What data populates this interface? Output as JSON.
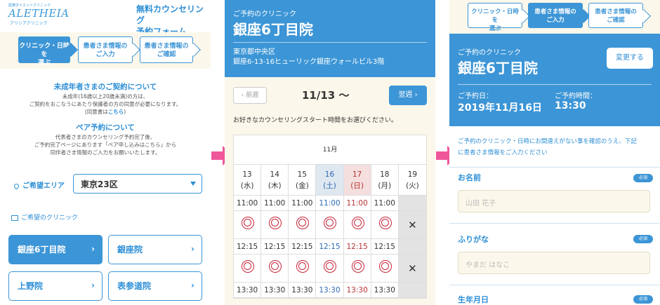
{
  "screen1": {
    "logo_sub": "医療ダイエットクリニック",
    "logo": "ALETHEIA",
    "logo_jp": "アリシアクリニック",
    "form_title_1": "無料カウンセリング",
    "form_title_2": "予約フォーム",
    "steps": [
      {
        "l1": "クリニック・日時を",
        "l2": "選ぶ"
      },
      {
        "l1": "患者さま情報の",
        "l2": "ご入力"
      },
      {
        "l1": "患者さま情報の",
        "l2": "ご確認"
      }
    ],
    "minor_heading": "未成年者さまのご契約について",
    "minor_text_1": "未成年(16歳以上20歳未満)の方は、",
    "minor_text_2": "ご契約をおこなうにあたり保護者の方の同意が必要になります。",
    "minor_text_3a": "(同意書は",
    "minor_text_3b": "こちら",
    "minor_text_3c": ")",
    "pair_heading": "ペア予約について",
    "pair_text_1": "代表者さまのカウンセリング予約完了後、",
    "pair_text_2": "ご予約完了ページにあります「ペア申し込みはこちら」から",
    "pair_text_3": "同伴者さま情報のご入力をお願いいたします。",
    "area_label": "ご希望エリア",
    "area_value": "東京23区",
    "clinic_label": "ご希望のクリニック",
    "clinics": [
      "銀座6丁目院",
      "銀座院",
      "上野院",
      "表参道院"
    ]
  },
  "screen2": {
    "sub": "ご予約のクリニック",
    "title": "銀座6丁目院",
    "addr_1": "東京都中央区",
    "addr_2": "銀座6-13-16ヒューリック銀座ウォールビル3階",
    "prev": "前週",
    "week": "11/13 〜",
    "next": "翌週",
    "choose": "お好きなカウンセリングスタート時間をお選びください。",
    "month": "11月",
    "days": [
      {
        "d": "13",
        "w": "(水)"
      },
      {
        "d": "14",
        "w": "(木)"
      },
      {
        "d": "15",
        "w": "(金)"
      },
      {
        "d": "16",
        "w": "(土)"
      },
      {
        "d": "17",
        "w": "(日)"
      },
      {
        "d": "18",
        "w": "(月)"
      },
      {
        "d": "19",
        "w": "(火)"
      }
    ],
    "times": [
      "11:00",
      "12:15",
      "13:30"
    ],
    "closed_mark": "✕"
  },
  "screen3": {
    "steps": [
      {
        "l1": "クリニック・日時を",
        "l2": "選ぶ"
      },
      {
        "l1": "患者さま情報の",
        "l2": "ご入力"
      },
      {
        "l1": "患者さま情報の",
        "l2": "ご確認"
      }
    ],
    "sub": "ご予約のクリニック",
    "title": "銀座6丁目院",
    "change": "変更する",
    "date_label": "ご予約日：",
    "date_value": "2019年11月16日",
    "time_label": "ご予約時間：",
    "time_value": "13:30",
    "confirm_1": "ご予約のクリニック・日時にお間違えがない事を確認のうえ、下記",
    "confirm_2": "に患者さま情報をご入力ください",
    "name_label": "お名前",
    "name_placeholder": "山田 花子",
    "kana_label": "ふりがな",
    "kana_placeholder": "やまだ はなこ",
    "birth_label": "生年月日",
    "required": "必須"
  },
  "colors": {
    "primary": "#3c95d6",
    "cream": "#fbf7ea",
    "arrow": "#f0569a",
    "reserve_mark": "#c9263a"
  }
}
